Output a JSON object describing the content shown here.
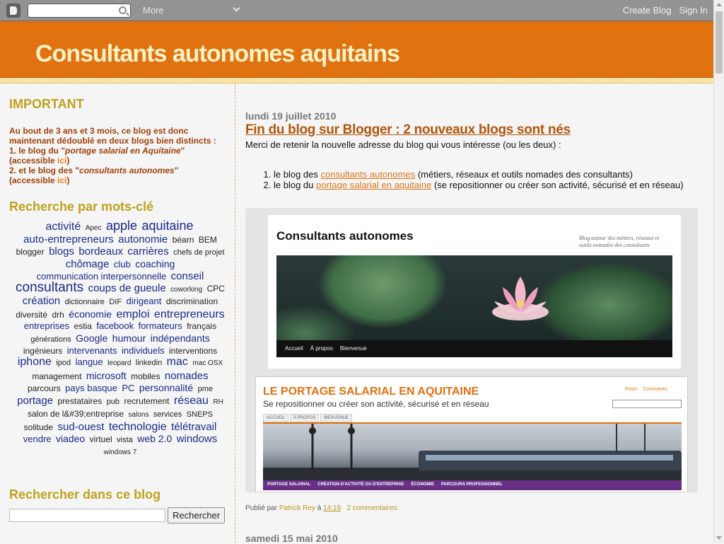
{
  "navbar": {
    "more_label": "More",
    "create_blog": "Create Blog",
    "sign_in": "Sign In"
  },
  "header": {
    "title": "Consultants autonomes aquitains"
  },
  "sidebar": {
    "important": {
      "title": "IMPORTANT",
      "line1": "Au bout de 3 ans et 3 mois, ce blog est donc maintenant dédoublé en deux blogs bien distincts :",
      "item1_prefix": "1. le blog du \"",
      "item1_name": "portage salarial en Aquitaine",
      "item1_suffix": "\"",
      "item1_access": "(accessible ",
      "item1_link": "ici",
      "item1_close": ")",
      "item2_prefix": "2. et le blog des \"",
      "item2_name": "consultants autonomes",
      "item2_suffix": "\"",
      "item2_access": "(accessible ",
      "item2_link": "ici",
      "item2_close": ")"
    },
    "tags_title": "Recherche par mots-clé",
    "tags": [
      {
        "label": "activité",
        "size": 16
      },
      {
        "label": "Apec",
        "size": 10
      },
      {
        "label": "apple",
        "size": 18
      },
      {
        "label": "aquitaine",
        "size": 18
      },
      {
        "label": "auto-entrepreneurs",
        "size": 15
      },
      {
        "label": "autonomie",
        "size": 15
      },
      {
        "label": "béarn",
        "size": 12
      },
      {
        "label": "BEM",
        "size": 12
      },
      {
        "label": "blogger",
        "size": 12
      },
      {
        "label": "blogs",
        "size": 15
      },
      {
        "label": "bordeaux",
        "size": 15
      },
      {
        "label": "carrières",
        "size": 15
      },
      {
        "label": "chefs de projet",
        "size": 11
      },
      {
        "label": "chômage",
        "size": 15
      },
      {
        "label": "club",
        "size": 13
      },
      {
        "label": "coaching",
        "size": 14
      },
      {
        "label": "communication interpersonnelle",
        "size": 13
      },
      {
        "label": "conseil",
        "size": 15
      },
      {
        "label": "consultants",
        "size": 19
      },
      {
        "label": "coups de gueule",
        "size": 15
      },
      {
        "label": "coworking",
        "size": 10
      },
      {
        "label": "CPC",
        "size": 12
      },
      {
        "label": "création",
        "size": 15
      },
      {
        "label": "dictionnaire",
        "size": 11
      },
      {
        "label": "DIF",
        "size": 11
      },
      {
        "label": "dirigeant",
        "size": 13
      },
      {
        "label": "discrimination",
        "size": 12
      },
      {
        "label": "diversité",
        "size": 12
      },
      {
        "label": "drh",
        "size": 12
      },
      {
        "label": "économie",
        "size": 14
      },
      {
        "label": "emploi",
        "size": 16
      },
      {
        "label": "entrepreneurs",
        "size": 16
      },
      {
        "label": "entreprises",
        "size": 13
      },
      {
        "label": "estia",
        "size": 12
      },
      {
        "label": "facebook",
        "size": 13
      },
      {
        "label": "formateurs",
        "size": 13
      },
      {
        "label": "français",
        "size": 12
      },
      {
        "label": "générations",
        "size": 11
      },
      {
        "label": "Google",
        "size": 14
      },
      {
        "label": "humour",
        "size": 14
      },
      {
        "label": "indépendants",
        "size": 14
      },
      {
        "label": "ingénieurs",
        "size": 12
      },
      {
        "label": "intervenants",
        "size": 13
      },
      {
        "label": "individuels",
        "size": 13
      },
      {
        "label": "interventions",
        "size": 12
      },
      {
        "label": "iphone",
        "size": 16
      },
      {
        "label": "ipod",
        "size": 11
      },
      {
        "label": "langue",
        "size": 13
      },
      {
        "label": "leopard",
        "size": 10
      },
      {
        "label": "linkedin",
        "size": 11
      },
      {
        "label": "mac",
        "size": 16
      },
      {
        "label": "mac OSX",
        "size": 10
      },
      {
        "label": "management",
        "size": 12
      },
      {
        "label": "microsoft",
        "size": 14
      },
      {
        "label": "mobiles",
        "size": 12
      },
      {
        "label": "nomades",
        "size": 15
      },
      {
        "label": "parcours",
        "size": 12
      },
      {
        "label": "pays basque",
        "size": 13
      },
      {
        "label": "PC",
        "size": 13
      },
      {
        "label": "personnalité",
        "size": 14
      },
      {
        "label": "pme",
        "size": 11
      },
      {
        "label": "portage",
        "size": 15
      },
      {
        "label": "prestataires",
        "size": 12
      },
      {
        "label": "pub",
        "size": 11
      },
      {
        "label": "recrutement",
        "size": 12
      },
      {
        "label": "réseau",
        "size": 16
      },
      {
        "label": "RH",
        "size": 10
      },
      {
        "label": "salon de l&#39;entreprise",
        "size": 12
      },
      {
        "label": "salons",
        "size": 10
      },
      {
        "label": "services",
        "size": 11
      },
      {
        "label": "SNEPS",
        "size": 11
      },
      {
        "label": "solitude",
        "size": 12
      },
      {
        "label": "sud-ouest",
        "size": 15
      },
      {
        "label": "technologie",
        "size": 16
      },
      {
        "label": "télétravail",
        "size": 15
      },
      {
        "label": "vendre",
        "size": 13
      },
      {
        "label": "viadeo",
        "size": 14
      },
      {
        "label": "virtuel",
        "size": 12
      },
      {
        "label": "vista",
        "size": 11
      },
      {
        "label": "web 2.0",
        "size": 14
      },
      {
        "label": "windows",
        "size": 15
      },
      {
        "label": "windows 7",
        "size": 10
      }
    ],
    "search_title": "Rechercher dans ce blog",
    "search_button": "Rechercher"
  },
  "post": {
    "date": "lundi 19 juillet 2010",
    "title": "Fin du blog sur Blogger : 2 nouveaux blogs sont nés",
    "intro": "Merci de retenir la nouvelle adresse du blog qui vous intéresse (ou les deux) :",
    "items": [
      {
        "prefix": "le blog des ",
        "link": "consultants autonomes",
        "suffix": " (métiers, réseaux et outils nomades des consultants)"
      },
      {
        "prefix": "le blog du ",
        "link": "portage salarial en aquitaine",
        "suffix": " (se repositionner ou créer son activité, sécurisé et en réseau)"
      }
    ],
    "shot1": {
      "title": "Consultants autonomes",
      "tagline": "Blog autour des métiers, réseaux et outils nomades des consultants",
      "menu": [
        "Accueil",
        "À propos",
        "Bienvenue"
      ]
    },
    "shot2": {
      "title": "LE PORTAGE SALARIAL EN AQUITAINE",
      "subtitle": "Se repositionner ou créer son activité, sécurisé et en réseau",
      "links": [
        "Posts",
        "Comments"
      ],
      "tabs": [
        "ACCUEIL",
        "À PROPOS",
        "BIENVENUE"
      ],
      "menu": [
        "PORTAGE SALARIAL",
        "CRÉATION D'ACTIVITÉ OU D'ENTREPRISE",
        "ÉCONOMIE",
        "PARCOURS PROFESSIONNEL"
      ]
    },
    "footer": {
      "published_by": "Publié par ",
      "author": "Patrick Rey",
      "at": " à ",
      "time": "14:19",
      "comments": "2 commentaires:"
    },
    "next_date": "samedi 15 mai 2010"
  }
}
